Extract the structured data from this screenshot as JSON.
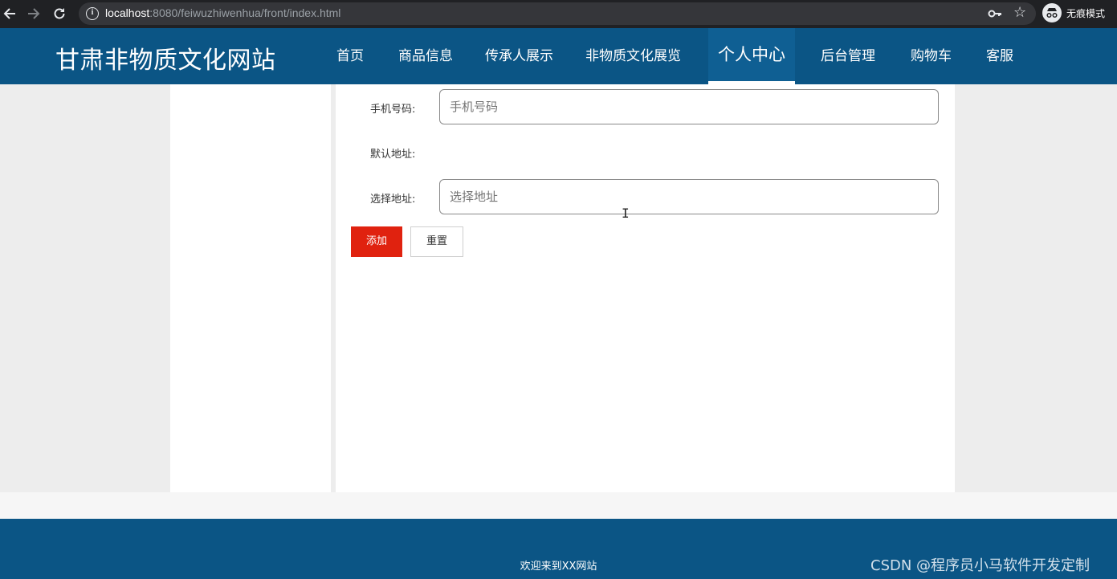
{
  "browser": {
    "url_host": "localhost",
    "url_path": ":8080/feiwuzhiwenhua/front/index.html",
    "incognito_label": "无痕模式"
  },
  "site": {
    "title": "甘肃非物质文化网站",
    "nav": [
      {
        "label": "首页"
      },
      {
        "label": "商品信息"
      },
      {
        "label": "传承人展示"
      },
      {
        "label": "非物质文化展览"
      },
      {
        "label": "个人中心"
      },
      {
        "label": "后台管理"
      },
      {
        "label": "购物车"
      },
      {
        "label": "客服"
      }
    ],
    "active_nav": "个人中心"
  },
  "form": {
    "phone_label": "手机号码:",
    "phone_placeholder": "手机号码",
    "default_address_label": "默认地址:",
    "address_label": "选择地址:",
    "address_placeholder": "选择地址",
    "add_button": "添加",
    "reset_button": "重置"
  },
  "footer": {
    "text": "欢迎来到XX网站"
  },
  "watermark": "CSDN @程序员小马软件开发定制",
  "colors": {
    "header_bg": "#0b5585",
    "primary_button": "#e0220f"
  }
}
